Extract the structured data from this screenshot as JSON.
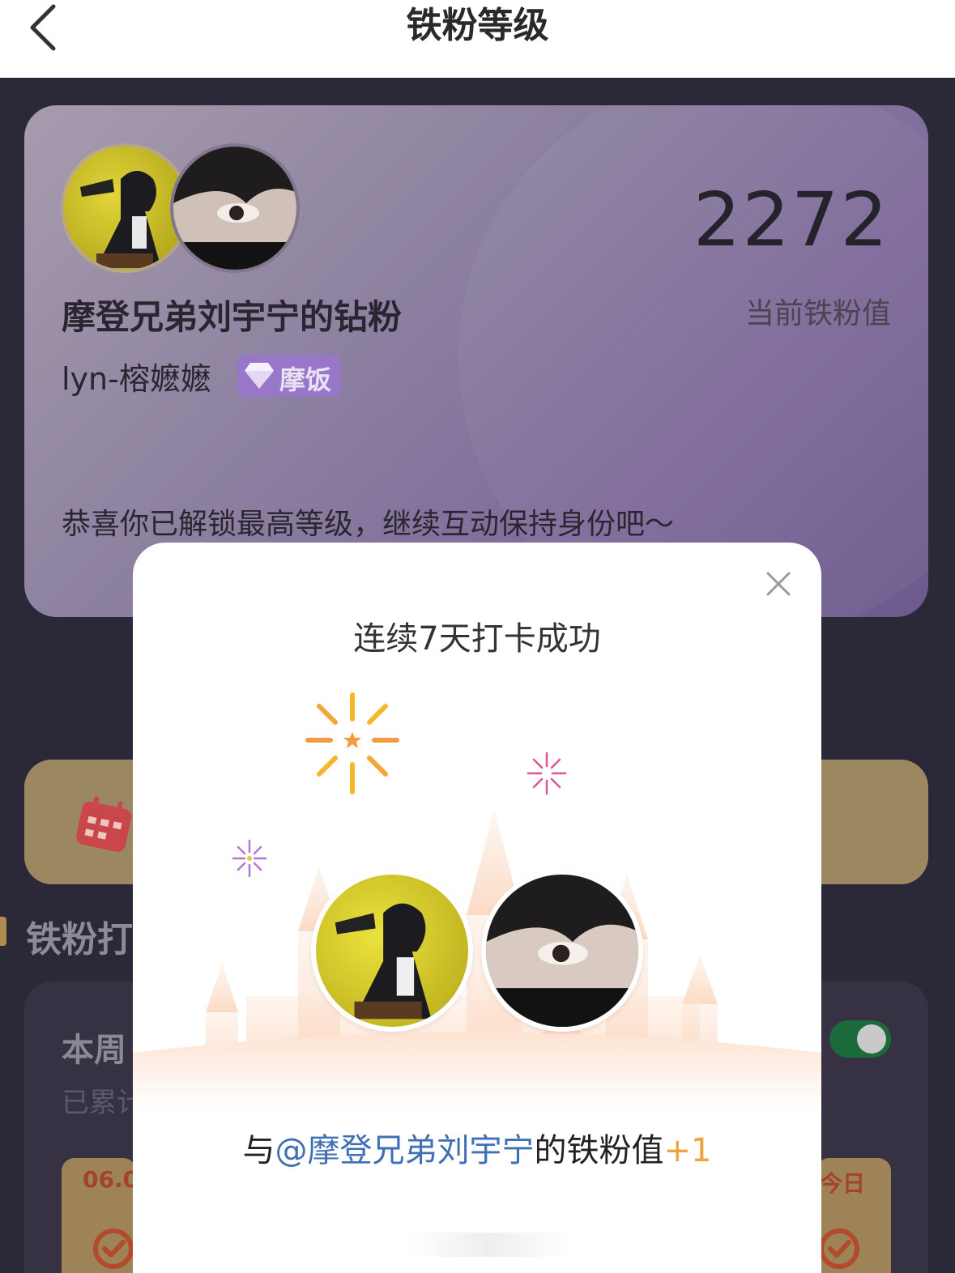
{
  "header": {
    "title": "铁粉等级"
  },
  "card": {
    "fan_name": "摩登兄弟刘宇宁的钻粉",
    "user_name": "lyn-榕嬷嬷",
    "badge_label": "摩饭",
    "score": "2272",
    "score_label": "当前铁粉值",
    "message": "恭喜你已解锁最高等级，继续互动保持身份吧～"
  },
  "section": {
    "title_partial": "铁粉打"
  },
  "week_card": {
    "title_partial": "本周",
    "subtitle_partial": "已累计",
    "day_left_label": "06.0",
    "day_right_label": "今日",
    "toggle_on": true
  },
  "modal": {
    "title": "连续7天打卡成功",
    "reward_prefix": "与",
    "reward_mention": "@摩登兄弟刘宇宁",
    "reward_middle": "的铁粉值",
    "reward_plus": "+1"
  },
  "colors": {
    "accent_blue": "#3f6fb6",
    "accent_orange": "#f0a23a",
    "badge_purple": "#9876c8",
    "toggle_green": "#1b6a3c"
  },
  "icons": [
    "back-arrow-icon",
    "diamond-icon",
    "calendar-icon",
    "close-icon",
    "check-circle-icon",
    "firework-icon"
  ]
}
